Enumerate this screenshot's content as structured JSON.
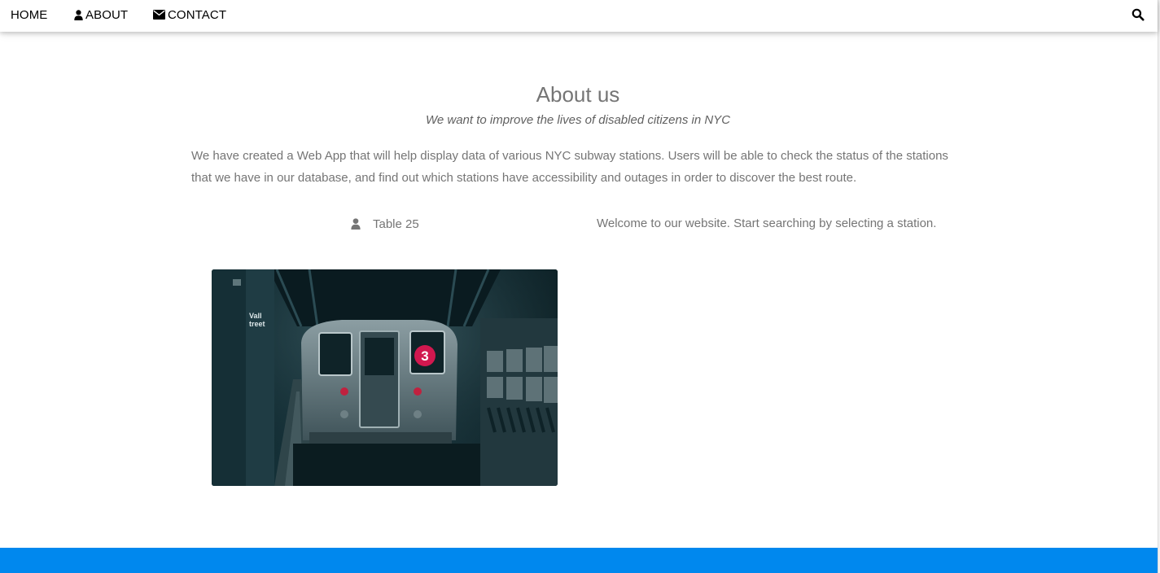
{
  "nav": {
    "home_label": "HOME",
    "about_label": "ABOUT",
    "contact_label": "CONTACT",
    "about_icon": "user-icon",
    "contact_icon": "envelope-icon",
    "search_icon": "search-icon"
  },
  "about": {
    "title": "About us",
    "tagline": "We want to improve the lives of disabled citizens in NYC",
    "description": "We have created a Web App that will help display data of various NYC subway stations. Users will be able to check the status of the stations that we have in our database, and find out which stations have accessibility and outages in order to discover the best route."
  },
  "team": {
    "icon": "user-icon",
    "label": "Table 25"
  },
  "welcome": {
    "message": "Welcome to our website. Start searching by selecting a station."
  },
  "photo": {
    "subject": "subway-train-photo",
    "sign_text": "Wall Street",
    "route_badge": "3"
  },
  "colors": {
    "footer_accent": "#0088ee",
    "text_gray": "#757575",
    "nav_text": "#000000",
    "route_badge": "#d1184f"
  }
}
